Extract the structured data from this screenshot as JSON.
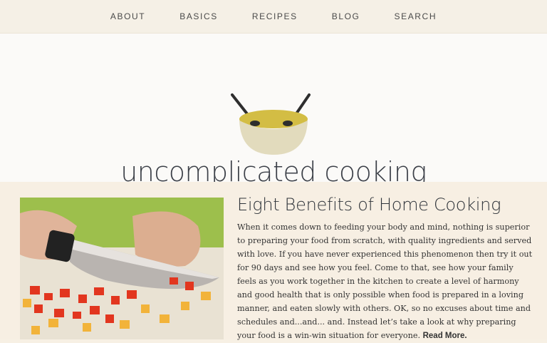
{
  "nav": {
    "items": [
      {
        "label": "ABOUT"
      },
      {
        "label": "BASICS"
      },
      {
        "label": "RECIPES"
      },
      {
        "label": "BLOG"
      },
      {
        "label": "SEARCH"
      }
    ]
  },
  "hero": {
    "site_title": "uncomplicated cooking",
    "logo_icon": "bowl-with-spoons-icon"
  },
  "article": {
    "title": "Eight Benefits of Home Cooking",
    "body": "When it comes down to feeding your body and mind, nothing is superior to preparing your food from scratch, with quality ingredients and served with love. If you have never experienced this phenomenon then try it out for 90 days and see how you feel. Come to that, see how your family feels as you work together in the kitchen to create a level of harmony and good health that is only possible when food is prepared in a loving manner, and eaten slowly with others. OK, so no excuses about time and schedules and...and... and. Instead let’s take a look at why preparing your food is a win-win situation for everyone.",
    "read_more": "Read More."
  },
  "colors": {
    "bowl_rim": "#d3bd44",
    "bowl_body": "#e2dbbd",
    "nav_bg": "#f5f0e6",
    "content_bg": "#f7efe3"
  }
}
